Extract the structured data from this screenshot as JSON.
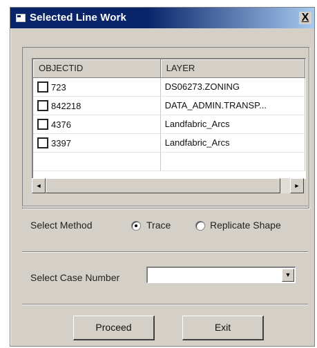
{
  "window": {
    "title": "Selected Line Work",
    "close_label": "X"
  },
  "grid": {
    "headers": [
      "OBJECTID",
      "LAYER"
    ],
    "rows": [
      {
        "objectid": "723",
        "layer": "DS06273.ZONING"
      },
      {
        "objectid": "842218",
        "layer": "DATA_ADMIN.TRANSP..."
      },
      {
        "objectid": "4376",
        "layer": "Landfabric_Arcs"
      },
      {
        "objectid": "3397",
        "layer": "Landfabric_Arcs"
      }
    ]
  },
  "scrollbar": {
    "left_icon": "◄",
    "right_icon": "►"
  },
  "select_method": {
    "label": "Select Method",
    "options": [
      {
        "label": "Trace",
        "selected": true
      },
      {
        "label": "Replicate Shape",
        "selected": false
      }
    ]
  },
  "case_number": {
    "label": "Select Case Number",
    "value": "",
    "dropdown_icon": "▼"
  },
  "buttons": {
    "proceed": "Proceed",
    "exit": "Exit"
  },
  "colors": {
    "titlebar": "#0a246a",
    "face": "#d4d0c8"
  }
}
